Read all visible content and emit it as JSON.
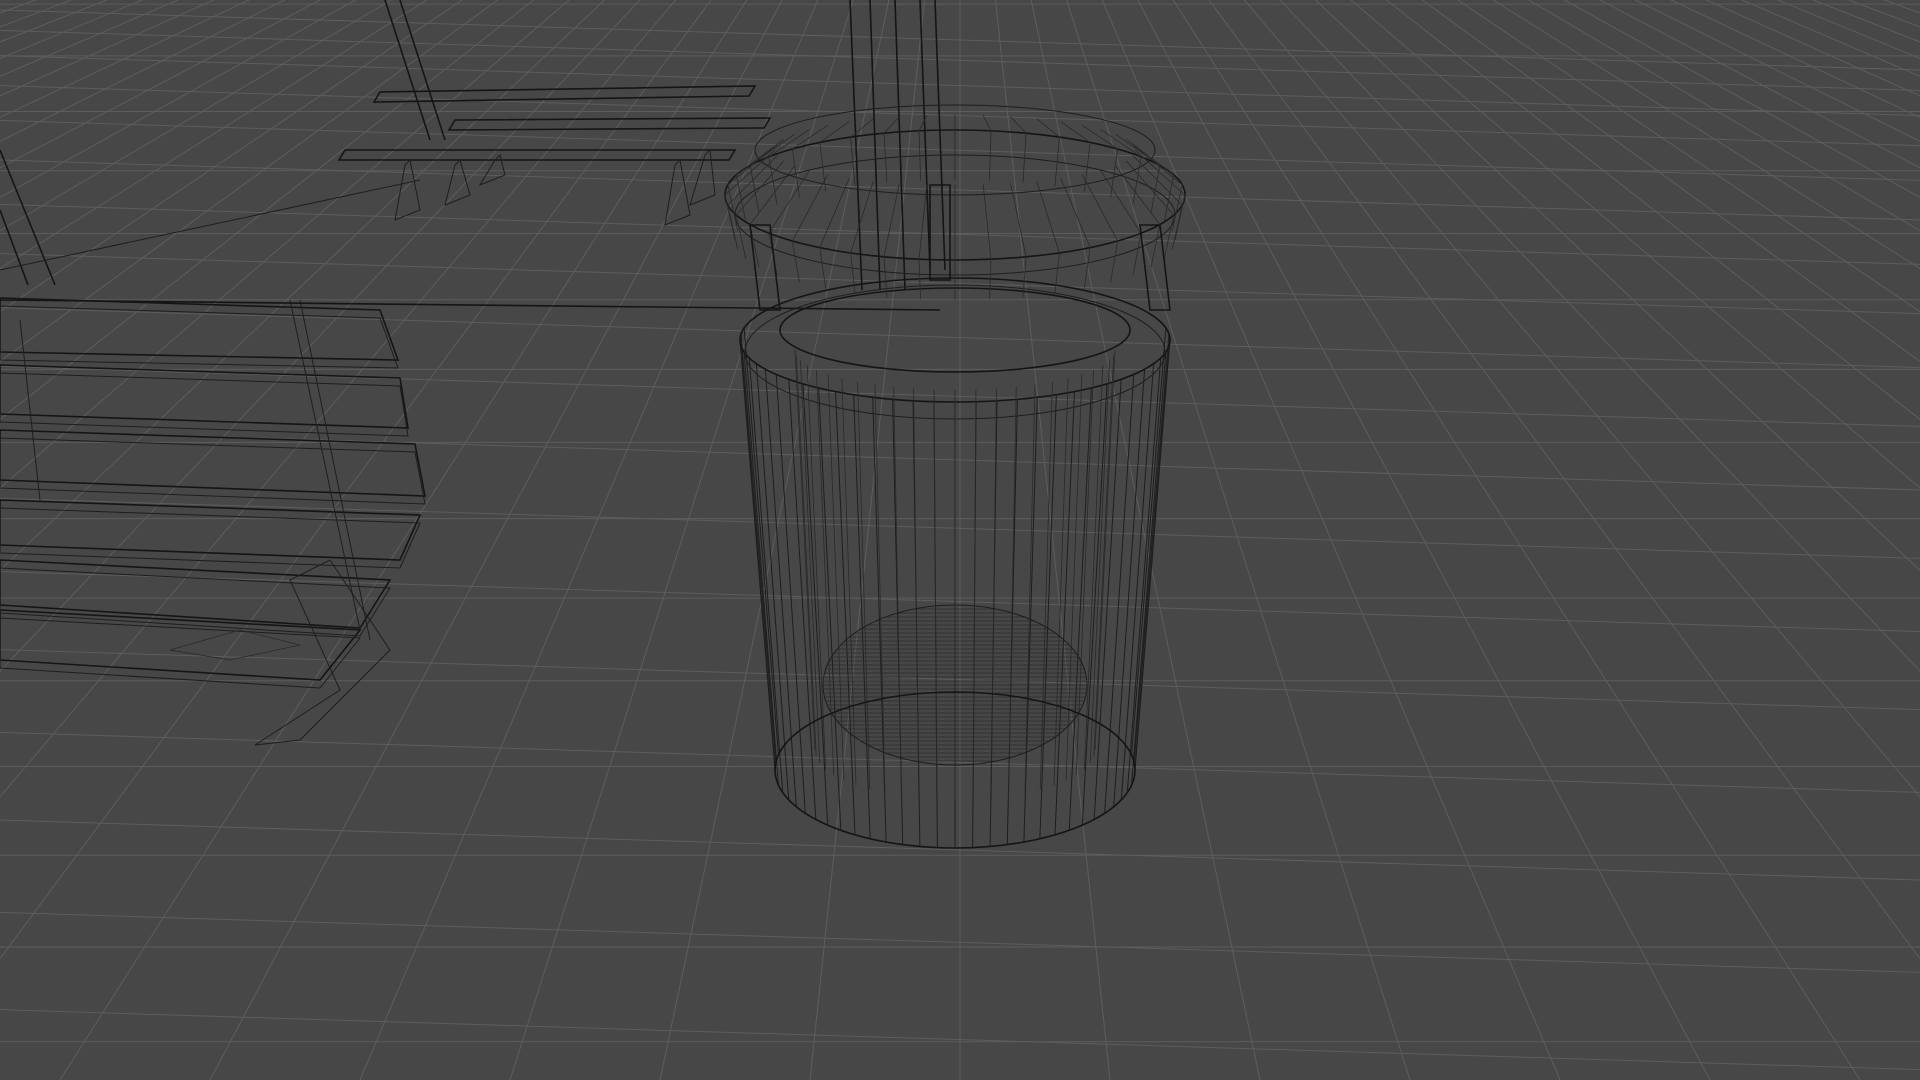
{
  "scene": {
    "view_mode": "wireframe",
    "background_color": "#474747",
    "grid_color": "#5d5d5d",
    "wire_color": "#1e1e1e",
    "objects": [
      {
        "id": "trash-bin",
        "kind": "cylindrical trash bin with dome lid"
      },
      {
        "id": "bench-near",
        "kind": "park bench"
      },
      {
        "id": "bench-far",
        "kind": "park bench"
      },
      {
        "id": "lamp-post",
        "kind": "post"
      }
    ]
  }
}
